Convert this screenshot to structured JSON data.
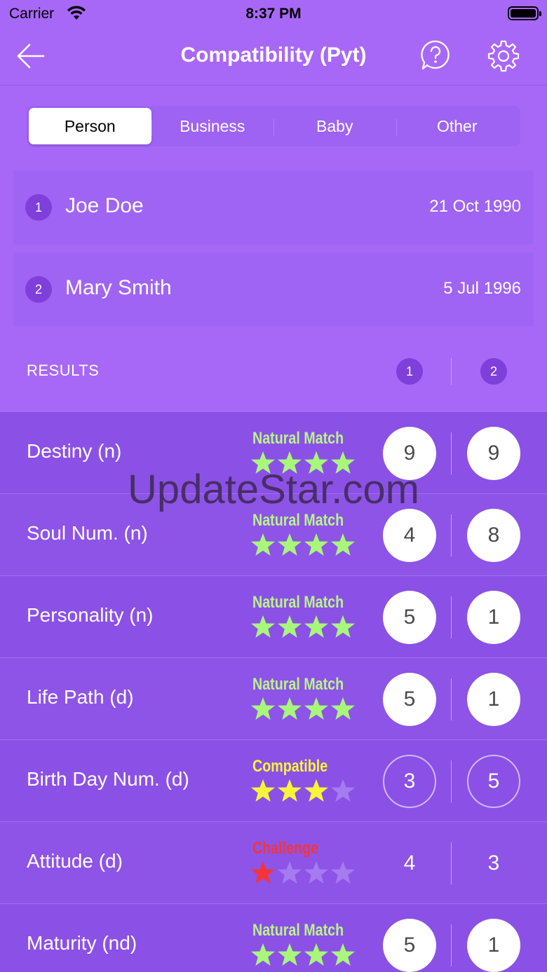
{
  "status_bar": {
    "carrier": "Carrier",
    "time": "8:37 PM"
  },
  "nav": {
    "title": "Compatibility (Pyt)",
    "icons": [
      "back-arrow-icon",
      "help-bubble-icon",
      "gear-icon"
    ]
  },
  "tabs": [
    {
      "label": "Person",
      "selected": true
    },
    {
      "label": "Business",
      "selected": false
    },
    {
      "label": "Baby",
      "selected": false
    },
    {
      "label": "Other",
      "selected": false
    }
  ],
  "people": [
    {
      "index": "1",
      "name": "Joe Doe",
      "date": "21 Oct 1990"
    },
    {
      "index": "2",
      "name": "Mary Smith",
      "date": "5 Jul 1996"
    }
  ],
  "results": {
    "label": "RESULTS",
    "col1": "1",
    "col2": "2",
    "rows": [
      {
        "label": "Destiny (n)",
        "match": "Natural Match",
        "match_color": "#b8f58a",
        "stars": 4,
        "star_color": "#a8f77a",
        "v1": "9",
        "v2": "9",
        "style": "solid"
      },
      {
        "label": "Soul Num. (n)",
        "match": "Natural Match",
        "match_color": "#b8f58a",
        "stars": 4,
        "star_color": "#a8f77a",
        "v1": "4",
        "v2": "8",
        "style": "solid"
      },
      {
        "label": "Personality (n)",
        "match": "Natural Match",
        "match_color": "#b8f58a",
        "stars": 4,
        "star_color": "#a8f77a",
        "v1": "5",
        "v2": "1",
        "style": "solid"
      },
      {
        "label": "Life Path (d)",
        "match": "Natural Match",
        "match_color": "#b8f58a",
        "stars": 4,
        "star_color": "#a8f77a",
        "v1": "5",
        "v2": "1",
        "style": "solid"
      },
      {
        "label": "Birth Day Num. (d)",
        "match": "Compatible",
        "match_color": "#f7f53a",
        "stars": 3,
        "star_color": "#f7f53a",
        "v1": "3",
        "v2": "5",
        "style": "outline"
      },
      {
        "label": "Attitude (d)",
        "match": "Challenge",
        "match_color": "#f4343a",
        "stars": 1,
        "star_color": "#f4343a",
        "v1": "4",
        "v2": "3",
        "style": "plain"
      },
      {
        "label": "Maturity (nd)",
        "match": "Natural Match",
        "match_color": "#b8f58a",
        "stars": 4,
        "star_color": "#a8f77a",
        "v1": "5",
        "v2": "1",
        "style": "solid"
      }
    ]
  },
  "watermark": "UpdateStar.com",
  "colors": {
    "background": "#a868f7",
    "card": "#9f64f3",
    "row": "#8c53e7",
    "badge": "#7f3fda",
    "star_empty": "#a47cf0"
  }
}
